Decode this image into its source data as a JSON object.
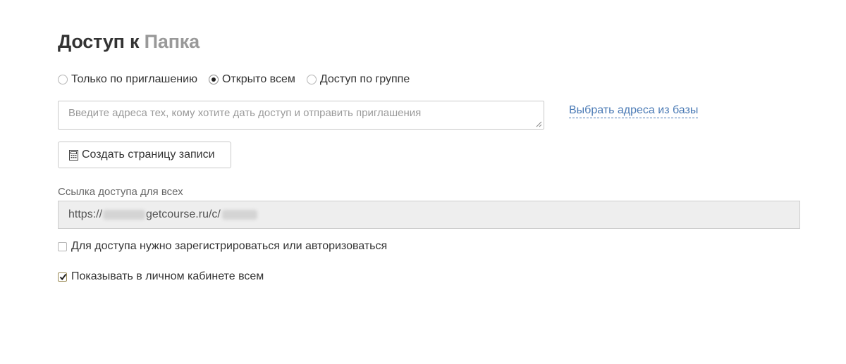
{
  "header": {
    "title_prefix": "Доступ к",
    "title_object": "Папка"
  },
  "access_mode": {
    "options": [
      {
        "label": "Только по приглашению",
        "checked": false
      },
      {
        "label": "Открыто всем",
        "checked": true
      },
      {
        "label": "Доступ по группе",
        "checked": false
      }
    ]
  },
  "invite": {
    "placeholder": "Введите адреса тех, кому хотите дать доступ и отправить приглашения",
    "value": "",
    "pick_link": "Выбрать адреса из базы"
  },
  "create_page_button": {
    "label": "Создать страницу записи",
    "icon": "calculator-icon"
  },
  "public_link": {
    "label": "Ссылка доступа для всех",
    "prefix": "https://",
    "domain": "getcourse.ru/c/"
  },
  "options": {
    "require_auth": {
      "label": "Для доступа нужно зарегистрироваться или авторизоваться",
      "checked": false
    },
    "show_in_cabinet": {
      "label": "Показывать в личном кабинете всем",
      "checked": true
    }
  },
  "colors": {
    "title_accent": "#999999",
    "link": "#4a7ab5",
    "field_bg": "#eeeeee"
  }
}
